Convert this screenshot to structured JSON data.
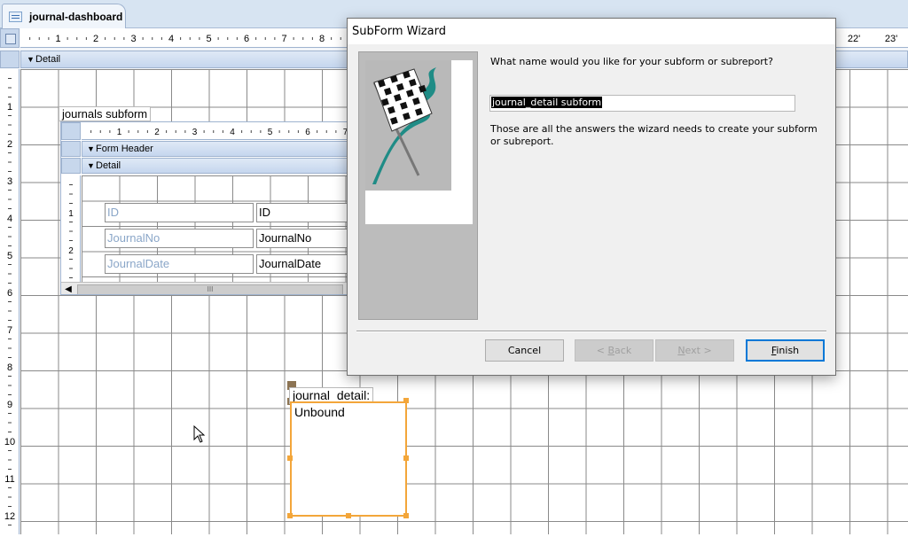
{
  "tab": {
    "label": "journal-dashboard",
    "icon": "form-icon"
  },
  "ruler": {
    "h_numbers": [
      "1",
      "2",
      "3",
      "4",
      "5",
      "6",
      "7",
      "8"
    ],
    "h_numbers_right": [
      "22'",
      "23'"
    ],
    "v_numbers": [
      "1",
      "2",
      "3",
      "4",
      "5",
      "6",
      "7",
      "8",
      "9",
      "10",
      "11",
      "12"
    ]
  },
  "main_section": {
    "label": "Detail"
  },
  "subform_label": "journals subform",
  "subform": {
    "ruler_numbers": [
      "1",
      "2",
      "3",
      "4",
      "5",
      "6",
      "7"
    ],
    "header_label": "Form Header",
    "detail_label": "Detail",
    "v_numbers": [
      "1",
      "2"
    ],
    "fields": [
      {
        "label": "ID",
        "value": "ID"
      },
      {
        "label": "JournalNo",
        "value": "JournalNo"
      },
      {
        "label": "JournalDate",
        "value": "JournalDate"
      }
    ],
    "scroll_glyph": "III"
  },
  "detail_control": {
    "label": "journal_detail:",
    "value": "Unbound"
  },
  "wizard": {
    "title": "SubForm Wizard",
    "prompt": "What name would you like for your subform or subreport?",
    "name_value": "journal_detail subform",
    "info": "Those are all the answers the wizard needs to create your subform or subreport.",
    "buttons": {
      "cancel": "Cancel",
      "back_prefix": "< ",
      "back_key": "B",
      "back_rest": "ack",
      "next_key": "N",
      "next_rest": "ext >",
      "finish_key": "F",
      "finish_rest": "inish"
    }
  },
  "colors": {
    "accent": "#0078d7",
    "selection": "#f3a63a",
    "section": "#c5d6ee"
  }
}
